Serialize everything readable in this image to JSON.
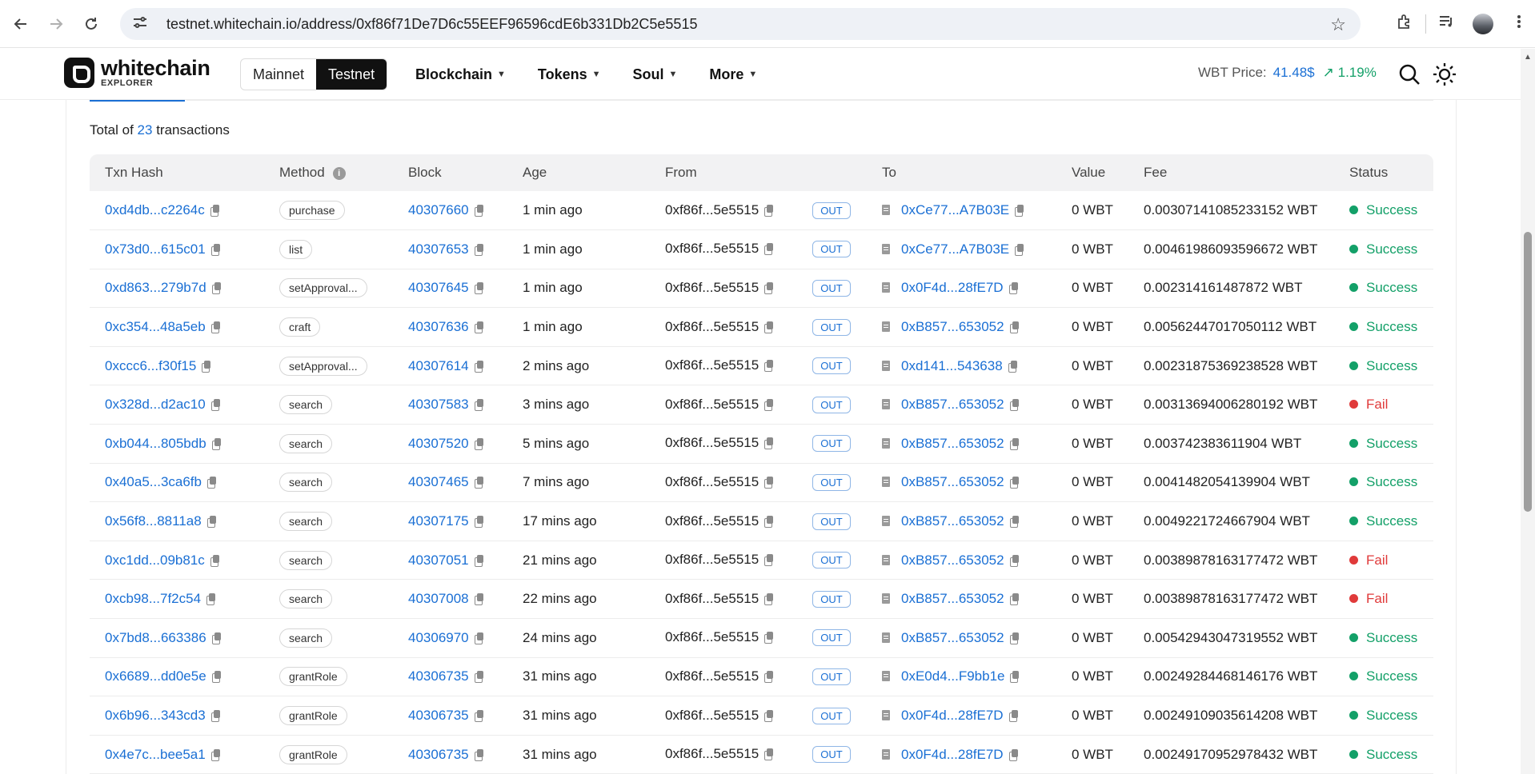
{
  "browser": {
    "url": "testnet.whitechain.io/address/0xf86f71De7D6c55EEF96596cdE6b331Db2C5e5515"
  },
  "site": {
    "logo_name": "whitechain",
    "logo_sub": "EXPLORER",
    "networks": [
      "Mainnet",
      "Testnet"
    ],
    "active_network": "Testnet",
    "nav": [
      "Blockchain",
      "Tokens",
      "Soul",
      "More"
    ],
    "price_label": "WBT Price:",
    "price_value": "41.48$",
    "price_change": "1.19%",
    "price_change_color": "#13a068",
    "accent": "#1a6fd4"
  },
  "summary": {
    "prefix": "Total of",
    "count": "23",
    "suffix": "transactions"
  },
  "table": {
    "headers": [
      "Txn Hash",
      "Method",
      "Block",
      "Age",
      "From",
      "To",
      "Value",
      "Fee",
      "Status"
    ],
    "rows": [
      {
        "hash": "0xd4db...c2264c",
        "method": "purchase",
        "block": "40307660",
        "age": "1 min ago",
        "from": "0xf86f...5e5515",
        "dir": "OUT",
        "to": "0xCe77...A7B03E",
        "value": "0 WBT",
        "fee": "0.00307141085233152 WBT",
        "status": "Success"
      },
      {
        "hash": "0x73d0...615c01",
        "method": "list",
        "block": "40307653",
        "age": "1 min ago",
        "from": "0xf86f...5e5515",
        "dir": "OUT",
        "to": "0xCe77...A7B03E",
        "value": "0 WBT",
        "fee": "0.00461986093596672 WBT",
        "status": "Success"
      },
      {
        "hash": "0xd863...279b7d",
        "method": "setApproval...",
        "block": "40307645",
        "age": "1 min ago",
        "from": "0xf86f...5e5515",
        "dir": "OUT",
        "to": "0x0F4d...28fE7D",
        "value": "0 WBT",
        "fee": "0.002314161487872 WBT",
        "status": "Success"
      },
      {
        "hash": "0xc354...48a5eb",
        "method": "craft",
        "block": "40307636",
        "age": "1 min ago",
        "from": "0xf86f...5e5515",
        "dir": "OUT",
        "to": "0xB857...653052",
        "value": "0 WBT",
        "fee": "0.00562447017050112 WBT",
        "status": "Success"
      },
      {
        "hash": "0xccc6...f30f15",
        "method": "setApproval...",
        "block": "40307614",
        "age": "2 mins ago",
        "from": "0xf86f...5e5515",
        "dir": "OUT",
        "to": "0xd141...543638",
        "value": "0 WBT",
        "fee": "0.00231875369238528 WBT",
        "status": "Success"
      },
      {
        "hash": "0x328d...d2ac10",
        "method": "search",
        "block": "40307583",
        "age": "3 mins ago",
        "from": "0xf86f...5e5515",
        "dir": "OUT",
        "to": "0xB857...653052",
        "value": "0 WBT",
        "fee": "0.00313694006280192 WBT",
        "status": "Fail"
      },
      {
        "hash": "0xb044...805bdb",
        "method": "search",
        "block": "40307520",
        "age": "5 mins ago",
        "from": "0xf86f...5e5515",
        "dir": "OUT",
        "to": "0xB857...653052",
        "value": "0 WBT",
        "fee": "0.003742383611904 WBT",
        "status": "Success"
      },
      {
        "hash": "0x40a5...3ca6fb",
        "method": "search",
        "block": "40307465",
        "age": "7 mins ago",
        "from": "0xf86f...5e5515",
        "dir": "OUT",
        "to": "0xB857...653052",
        "value": "0 WBT",
        "fee": "0.0041482054139904 WBT",
        "status": "Success"
      },
      {
        "hash": "0x56f8...8811a8",
        "method": "search",
        "block": "40307175",
        "age": "17 mins ago",
        "from": "0xf86f...5e5515",
        "dir": "OUT",
        "to": "0xB857...653052",
        "value": "0 WBT",
        "fee": "0.0049221724667904 WBT",
        "status": "Success"
      },
      {
        "hash": "0xc1dd...09b81c",
        "method": "search",
        "block": "40307051",
        "age": "21 mins ago",
        "from": "0xf86f...5e5515",
        "dir": "OUT",
        "to": "0xB857...653052",
        "value": "0 WBT",
        "fee": "0.00389878163177472 WBT",
        "status": "Fail"
      },
      {
        "hash": "0xcb98...7f2c54",
        "method": "search",
        "block": "40307008",
        "age": "22 mins ago",
        "from": "0xf86f...5e5515",
        "dir": "OUT",
        "to": "0xB857...653052",
        "value": "0 WBT",
        "fee": "0.00389878163177472 WBT",
        "status": "Fail"
      },
      {
        "hash": "0x7bd8...663386",
        "method": "search",
        "block": "40306970",
        "age": "24 mins ago",
        "from": "0xf86f...5e5515",
        "dir": "OUT",
        "to": "0xB857...653052",
        "value": "0 WBT",
        "fee": "0.00542943047319552 WBT",
        "status": "Success"
      },
      {
        "hash": "0x6689...dd0e5e",
        "method": "grantRole",
        "block": "40306735",
        "age": "31 mins ago",
        "from": "0xf86f...5e5515",
        "dir": "OUT",
        "to": "0xE0d4...F9bb1e",
        "value": "0 WBT",
        "fee": "0.00249284468146176 WBT",
        "status": "Success"
      },
      {
        "hash": "0x6b96...343cd3",
        "method": "grantRole",
        "block": "40306735",
        "age": "31 mins ago",
        "from": "0xf86f...5e5515",
        "dir": "OUT",
        "to": "0x0F4d...28fE7D",
        "value": "0 WBT",
        "fee": "0.00249109035614208 WBT",
        "status": "Success"
      },
      {
        "hash": "0x4e7c...bee5a1",
        "method": "grantRole",
        "block": "40306735",
        "age": "31 mins ago",
        "from": "0xf86f...5e5515",
        "dir": "OUT",
        "to": "0x0F4d...28fE7D",
        "value": "0 WBT",
        "fee": "0.00249170952978432 WBT",
        "status": "Success"
      }
    ]
  },
  "colors": {
    "success": "#13a068",
    "fail": "#e03a3a"
  }
}
